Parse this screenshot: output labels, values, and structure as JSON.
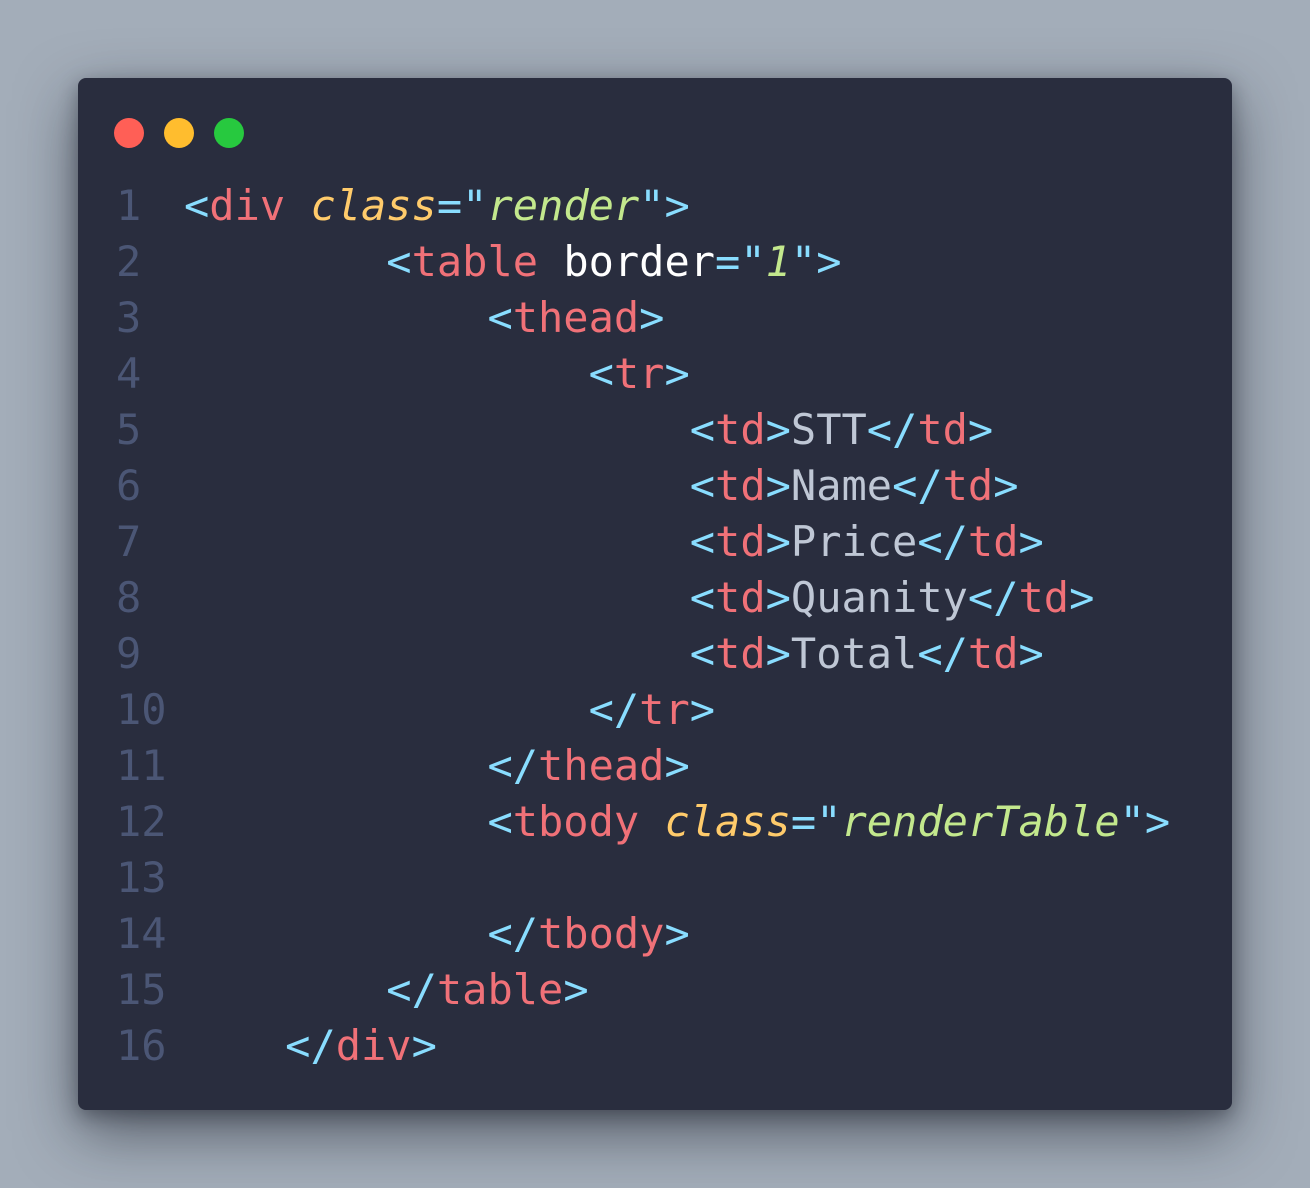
{
  "window": {
    "controls": [
      {
        "name": "close",
        "color": "#ff5f56"
      },
      {
        "name": "minimize",
        "color": "#ffbd2e"
      },
      {
        "name": "maximize",
        "color": "#27c93f"
      }
    ]
  },
  "colors": {
    "background": "#a3adb9",
    "editor": "#292d3e",
    "line_number": "#4b5675",
    "punctuation": "#89ddff",
    "tag": "#f07178",
    "attribute": "#ffcb6b",
    "string": "#c3e88d",
    "text": "#bfc7d5"
  },
  "code": {
    "lines": [
      {
        "number": "1",
        "tokens": [
          {
            "t": "<",
            "k": "punct"
          },
          {
            "t": "div",
            "k": "tag"
          },
          {
            "t": " ",
            "k": "space"
          },
          {
            "t": "class",
            "k": "attr-italic"
          },
          {
            "t": "=\"",
            "k": "punct"
          },
          {
            "t": "render",
            "k": "str"
          },
          {
            "t": "\">",
            "k": "punct"
          }
        ]
      },
      {
        "number": "2",
        "tokens": [
          {
            "t": "        ",
            "k": "space"
          },
          {
            "t": "<",
            "k": "punct"
          },
          {
            "t": "table",
            "k": "tag"
          },
          {
            "t": " ",
            "k": "space"
          },
          {
            "t": "border",
            "k": "attr-plain"
          },
          {
            "t": "=\"",
            "k": "punct"
          },
          {
            "t": "1",
            "k": "str"
          },
          {
            "t": "\">",
            "k": "punct"
          }
        ]
      },
      {
        "number": "3",
        "tokens": [
          {
            "t": "            ",
            "k": "space"
          },
          {
            "t": "<",
            "k": "punct"
          },
          {
            "t": "thead",
            "k": "tag"
          },
          {
            "t": ">",
            "k": "punct"
          }
        ]
      },
      {
        "number": "4",
        "tokens": [
          {
            "t": "                ",
            "k": "space"
          },
          {
            "t": "<",
            "k": "punct"
          },
          {
            "t": "tr",
            "k": "tag"
          },
          {
            "t": ">",
            "k": "punct"
          }
        ]
      },
      {
        "number": "5",
        "tokens": [
          {
            "t": "                    ",
            "k": "space"
          },
          {
            "t": "<",
            "k": "punct"
          },
          {
            "t": "td",
            "k": "tag"
          },
          {
            "t": ">",
            "k": "punct"
          },
          {
            "t": "STT",
            "k": "text"
          },
          {
            "t": "</",
            "k": "punct"
          },
          {
            "t": "td",
            "k": "tag"
          },
          {
            "t": ">",
            "k": "punct"
          }
        ]
      },
      {
        "number": "6",
        "tokens": [
          {
            "t": "                    ",
            "k": "space"
          },
          {
            "t": "<",
            "k": "punct"
          },
          {
            "t": "td",
            "k": "tag"
          },
          {
            "t": ">",
            "k": "punct"
          },
          {
            "t": "Name",
            "k": "text"
          },
          {
            "t": "</",
            "k": "punct"
          },
          {
            "t": "td",
            "k": "tag"
          },
          {
            "t": ">",
            "k": "punct"
          }
        ]
      },
      {
        "number": "7",
        "tokens": [
          {
            "t": "                    ",
            "k": "space"
          },
          {
            "t": "<",
            "k": "punct"
          },
          {
            "t": "td",
            "k": "tag"
          },
          {
            "t": ">",
            "k": "punct"
          },
          {
            "t": "Price",
            "k": "text"
          },
          {
            "t": "</",
            "k": "punct"
          },
          {
            "t": "td",
            "k": "tag"
          },
          {
            "t": ">",
            "k": "punct"
          }
        ]
      },
      {
        "number": "8",
        "tokens": [
          {
            "t": "                    ",
            "k": "space"
          },
          {
            "t": "<",
            "k": "punct"
          },
          {
            "t": "td",
            "k": "tag"
          },
          {
            "t": ">",
            "k": "punct"
          },
          {
            "t": "Quanity",
            "k": "text"
          },
          {
            "t": "</",
            "k": "punct"
          },
          {
            "t": "td",
            "k": "tag"
          },
          {
            "t": ">",
            "k": "punct"
          }
        ]
      },
      {
        "number": "9",
        "tokens": [
          {
            "t": "                    ",
            "k": "space"
          },
          {
            "t": "<",
            "k": "punct"
          },
          {
            "t": "td",
            "k": "tag"
          },
          {
            "t": ">",
            "k": "punct"
          },
          {
            "t": "Total",
            "k": "text"
          },
          {
            "t": "</",
            "k": "punct"
          },
          {
            "t": "td",
            "k": "tag"
          },
          {
            "t": ">",
            "k": "punct"
          }
        ]
      },
      {
        "number": "10",
        "tokens": [
          {
            "t": "                ",
            "k": "space"
          },
          {
            "t": "</",
            "k": "punct"
          },
          {
            "t": "tr",
            "k": "tag"
          },
          {
            "t": ">",
            "k": "punct"
          }
        ]
      },
      {
        "number": "11",
        "tokens": [
          {
            "t": "            ",
            "k": "space"
          },
          {
            "t": "</",
            "k": "punct"
          },
          {
            "t": "thead",
            "k": "tag"
          },
          {
            "t": ">",
            "k": "punct"
          }
        ]
      },
      {
        "number": "12",
        "tokens": [
          {
            "t": "            ",
            "k": "space"
          },
          {
            "t": "<",
            "k": "punct"
          },
          {
            "t": "tbody",
            "k": "tag"
          },
          {
            "t": " ",
            "k": "space"
          },
          {
            "t": "class",
            "k": "attr-italic"
          },
          {
            "t": "=\"",
            "k": "punct"
          },
          {
            "t": "renderTable",
            "k": "str"
          },
          {
            "t": "\">",
            "k": "punct"
          }
        ]
      },
      {
        "number": "13",
        "tokens": []
      },
      {
        "number": "14",
        "tokens": [
          {
            "t": "            ",
            "k": "space"
          },
          {
            "t": "</",
            "k": "punct"
          },
          {
            "t": "tbody",
            "k": "tag"
          },
          {
            "t": ">",
            "k": "punct"
          }
        ]
      },
      {
        "number": "15",
        "tokens": [
          {
            "t": "        ",
            "k": "space"
          },
          {
            "t": "</",
            "k": "punct"
          },
          {
            "t": "table",
            "k": "tag"
          },
          {
            "t": ">",
            "k": "punct"
          }
        ]
      },
      {
        "number": "16",
        "tokens": [
          {
            "t": "    ",
            "k": "space"
          },
          {
            "t": "</",
            "k": "punct"
          },
          {
            "t": "div",
            "k": "tag"
          },
          {
            "t": ">",
            "k": "punct"
          }
        ]
      }
    ]
  }
}
